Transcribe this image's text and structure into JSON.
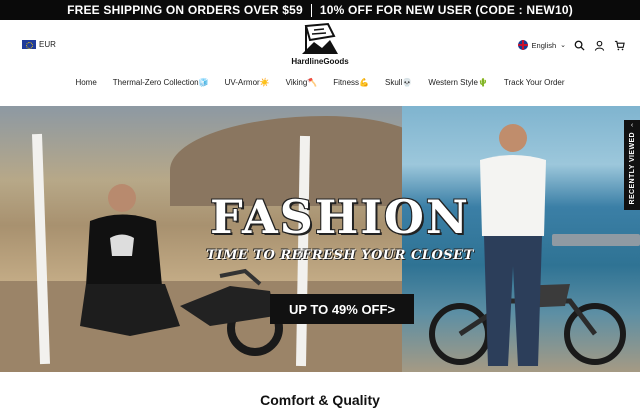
{
  "promo": {
    "left": "FREE SHIPPING ON ORDERS OVER $59",
    "right": "10% OFF FOR NEW USER (CODE : NEW10)"
  },
  "header": {
    "currency": "EUR",
    "logo_text": "HardlineGoods",
    "language": "English",
    "icons": [
      "eu-flag-icon",
      "flag-icon",
      "chevron-down-icon",
      "search-icon",
      "user-icon",
      "cart-icon"
    ]
  },
  "nav": {
    "items": [
      {
        "label": "Home"
      },
      {
        "label": "Thermal-Zero Collection🧊"
      },
      {
        "label": "UV-Armor☀️"
      },
      {
        "label": "Viking🪓"
      },
      {
        "label": "Fitness💪"
      },
      {
        "label": "Skull💀"
      },
      {
        "label": "Western Style🌵"
      },
      {
        "label": "Track Your Order"
      }
    ]
  },
  "hero": {
    "title": "FASHION",
    "subtitle": "TIME TO REFRESH YOUR CLOSET",
    "cta": "UP TO 49% OFF>"
  },
  "recently_viewed": {
    "label": "RECENTLY VIEWED"
  },
  "section": {
    "heading": "Comfort & Quality"
  },
  "colors": {
    "promo_bg": "#0a0a0a",
    "cta_bg": "#111111",
    "text": "#222222"
  }
}
